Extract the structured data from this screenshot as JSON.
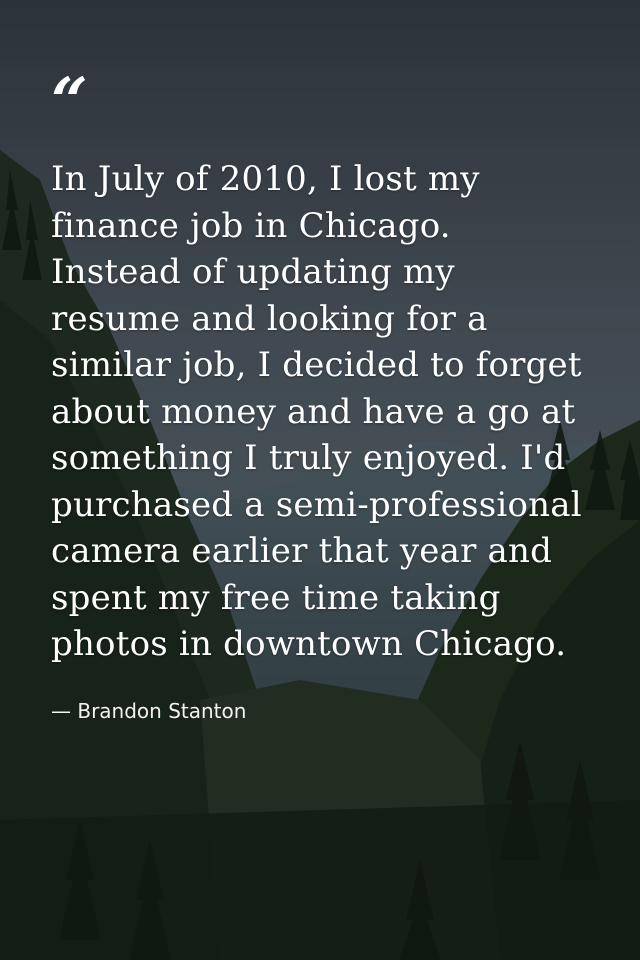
{
  "quote": {
    "mark": "“",
    "text": "In July of 2010, I lost my finance job in Chicago. Instead of updating my resume and looking for a similar job, I decided to forget about money and have a go at something I truly enjoyed. I'd purchased a semi-professional camera earlier that year and spent my free time taking photos in downtown Chicago.",
    "author": "— Brandon Stanton"
  },
  "background": {
    "description_icon": "forest-mountain-background",
    "sky_color": "#4a525c",
    "forest_color": "#1f2d22"
  }
}
